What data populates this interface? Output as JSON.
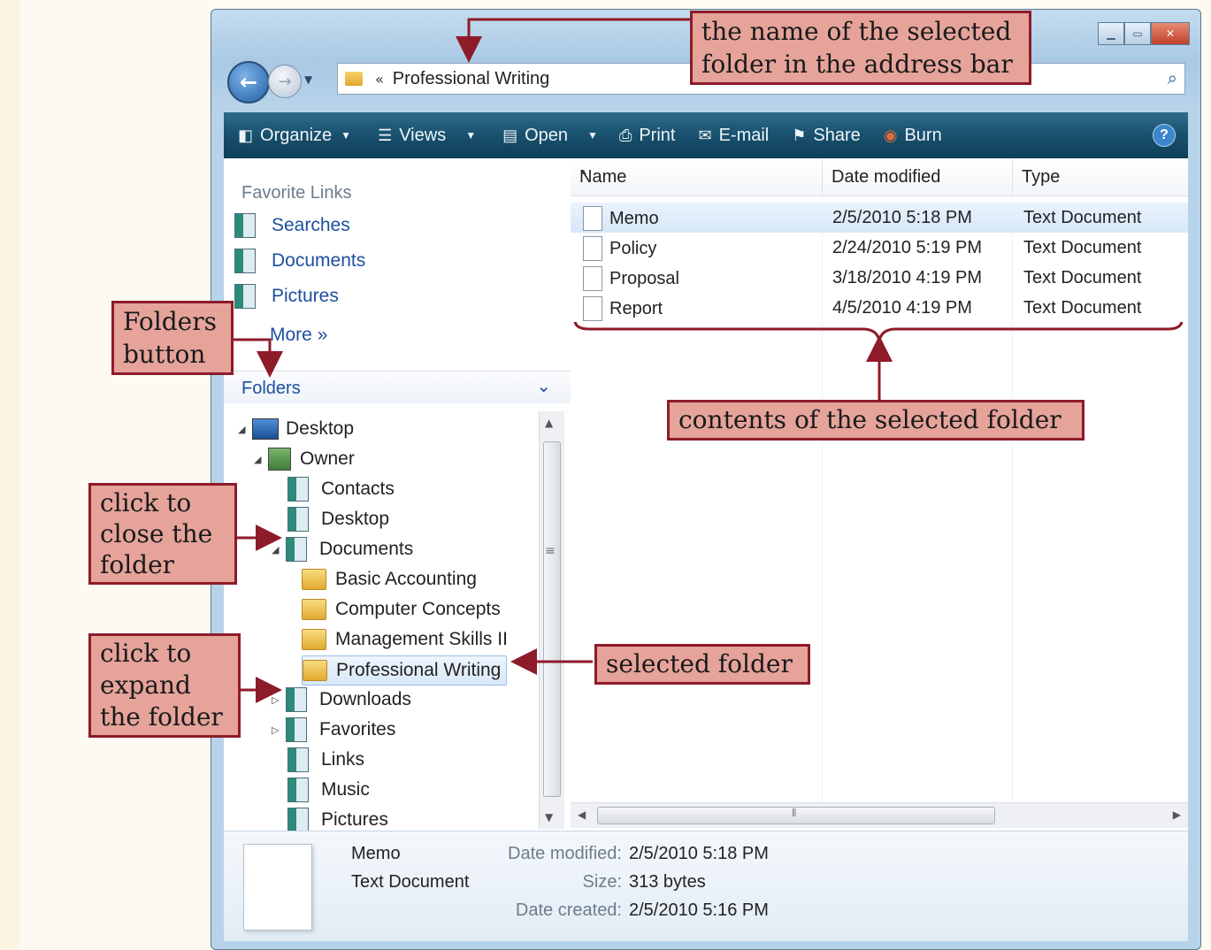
{
  "address": {
    "path": "Professional Writing",
    "crumb": "«"
  },
  "toolbar": {
    "organize": "Organize",
    "views": "Views",
    "open": "Open",
    "print": "Print",
    "email": "E-mail",
    "share": "Share",
    "burn": "Burn",
    "help": "?"
  },
  "favorites": {
    "heading": "Favorite Links",
    "items": [
      "Searches",
      "Documents",
      "Pictures"
    ],
    "more": "More",
    "more_chev": "»"
  },
  "folders": {
    "label": "Folders",
    "tree": [
      "Desktop",
      "Owner",
      "Contacts",
      "Desktop",
      "Documents",
      "Basic Accounting",
      "Computer Concepts",
      "Management Skills II",
      "Professional Writing",
      "Downloads",
      "Favorites",
      "Links",
      "Music",
      "Pictures"
    ]
  },
  "columns": {
    "name": "Name",
    "date": "Date modified",
    "type": "Type"
  },
  "files": [
    {
      "name": "Memo",
      "date": "2/5/2010 5:18 PM",
      "type": "Text Document"
    },
    {
      "name": "Policy",
      "date": "2/24/2010 5:19 PM",
      "type": "Text Document"
    },
    {
      "name": "Proposal",
      "date": "3/18/2010 4:19 PM",
      "type": "Text Document"
    },
    {
      "name": "Report",
      "date": "4/5/2010 4:19 PM",
      "type": "Text Document"
    }
  ],
  "details": {
    "name": "Memo",
    "type": "Text Document",
    "modified_label": "Date modified:",
    "modified_value": "2/5/2010 5:18 PM",
    "size_label": "Size:",
    "size_value": "313 bytes",
    "created_label": "Date created:",
    "created_value": "2/5/2010 5:16 PM"
  },
  "callouts": {
    "address_bar": "the name of the selected folder in the address bar",
    "folders_button": "Folders button",
    "click_close": "click to close the folder",
    "click_expand": "click to expand the folder",
    "contents": "contents of the selected folder",
    "selected_folder": "selected folder"
  },
  "colors": {
    "callout_fill": "#e5a39a",
    "callout_border": "#8e1b2a",
    "toolbar": "#18506d",
    "link": "#1e4fa0"
  }
}
